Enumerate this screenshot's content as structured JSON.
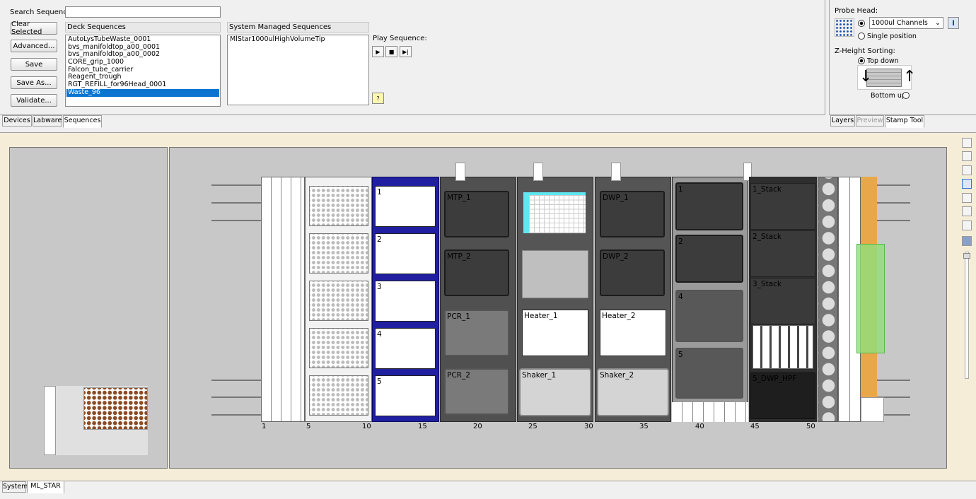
{
  "search": {
    "label": "Search Sequence:",
    "value": ""
  },
  "buttons": {
    "clear": "Clear Selected",
    "advanced": "Advanced...",
    "save": "Save",
    "save_as": "Save As...",
    "validate": "Validate..."
  },
  "deck_sequences": {
    "header": "Deck Sequences",
    "items": [
      "AutoLysTubeWaste_0001",
      "bvs_manifoldtop_a00_0001",
      "bvs_manifoldtop_a00_0002",
      "CORE_grip_1000",
      "Falcon_tube_carrier",
      "Reagent_trough",
      "RGT_REFILL_for96Head_0001",
      "Waste_96"
    ],
    "selected_index": 7
  },
  "system_sequences": {
    "header": "System Managed Sequences",
    "items": [
      "MlStar1000ulHighVolumeTip"
    ]
  },
  "play": {
    "label": "Play Sequence:"
  },
  "top_tabs": [
    "Devices",
    "Labware",
    "Sequences"
  ],
  "probe": {
    "label": "Probe Head:",
    "channels_value": "1000ul Channels",
    "single": "Single position",
    "zsort_label": "Z-Height Sorting:",
    "top_down": "Top down",
    "bottom_up": "Bottom up"
  },
  "right_tabs": [
    "Layers",
    "Preview",
    "Stamp Tool"
  ],
  "deck": {
    "ticks": [
      "1",
      "5",
      "10",
      "15",
      "20",
      "25",
      "30",
      "35",
      "40",
      "45",
      "50"
    ],
    "slots": [
      "1",
      "2",
      "3",
      "4",
      "5"
    ],
    "car1": [
      "MTP_1",
      "MTP_2",
      "PCR_1",
      "PCR_2"
    ],
    "car2": [
      "Heater_1",
      "Shaker_1"
    ],
    "car3": [
      "DWP_1",
      "DWP_2",
      "Heater_2",
      "Shaker_2"
    ],
    "car4": [
      "1",
      "2",
      "4",
      "5"
    ],
    "stack": [
      "1_Stack",
      "2_Stack",
      "3_Stack",
      "5_DWP_HPF"
    ]
  },
  "bottom_tabs": [
    "System",
    "ML_STAR"
  ],
  "colors": {
    "selection": "#0a74d0",
    "deck_bg": "#c8c8c8",
    "frame_bg": "#f5edd8",
    "blue_carrier": "#1f1fa0",
    "orange": "#e8a84a",
    "green": "#8fe07a"
  }
}
